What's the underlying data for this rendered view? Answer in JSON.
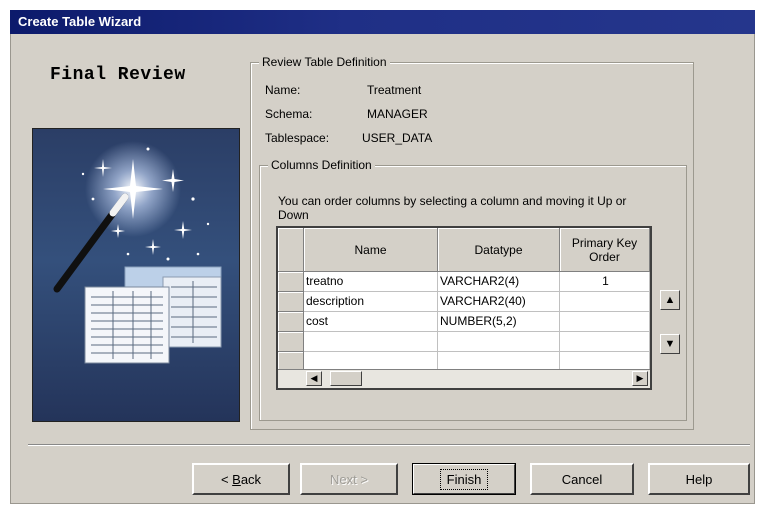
{
  "window": {
    "title": "Create Table Wizard"
  },
  "step_title": "Final Review",
  "review": {
    "group_label": "Review Table Definition",
    "name_label": "Name:",
    "name_value": "Treatment",
    "schema_label": "Schema:",
    "schema_value": "MANAGER",
    "tablespace_label": "Tablespace:",
    "tablespace_value": "USER_DATA"
  },
  "columns": {
    "group_label": "Columns Definition",
    "instructions": "You can order columns by selecting a column and moving it Up or Down",
    "headers": {
      "name": "Name",
      "datatype": "Datatype",
      "pk_order": "Primary Key Order"
    },
    "rows": [
      {
        "name": "treatno",
        "datatype": "VARCHAR2(4)",
        "pk": "1"
      },
      {
        "name": "description",
        "datatype": "VARCHAR2(40)",
        "pk": ""
      },
      {
        "name": "cost",
        "datatype": "NUMBER(5,2)",
        "pk": ""
      }
    ],
    "move_up_icon": "arrow-up-icon",
    "move_down_icon": "arrow-down-icon"
  },
  "buttons": {
    "back_prefix": "< ",
    "back_accel": "B",
    "back_rest": "ack",
    "next": "Next >",
    "finish": "Finish",
    "cancel": "Cancel",
    "help": "Help"
  }
}
